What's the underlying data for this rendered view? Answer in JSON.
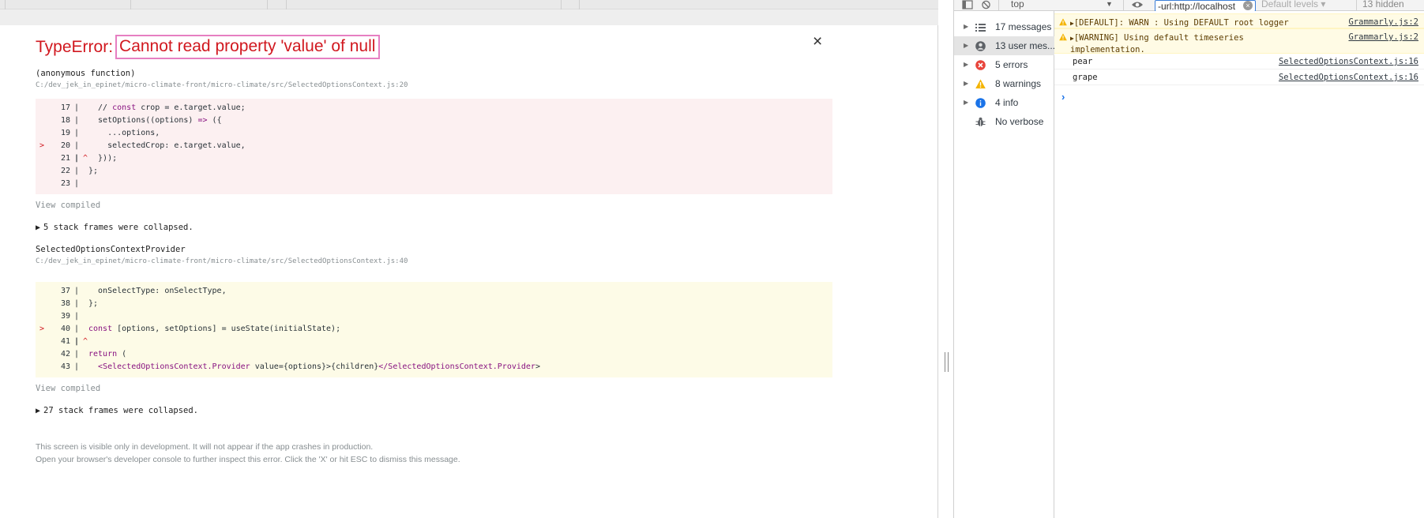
{
  "error": {
    "type": "TypeError:",
    "message": "Cannot read property 'value' of null",
    "close": "×"
  },
  "frame1": {
    "function": "(anonymous function)",
    "path": "C:/dev_jek_in_epinet/micro-climate-front/micro-climate/src/SelectedOptionsContext.js:20",
    "lines": [
      {
        "num": "17",
        "code": "  // const crop = e.target.value;"
      },
      {
        "num": "18",
        "code": "  setOptions((options) => ({"
      },
      {
        "num": "19",
        "code": "    ...options,"
      },
      {
        "num": "20",
        "code": "    selectedCrop: e.target.value,",
        "marker": ">"
      },
      {
        "num": "21",
        "code": "  }));",
        "caret": "^"
      },
      {
        "num": "22",
        "code": "};"
      },
      {
        "num": "23",
        "code": ""
      }
    ],
    "view_compiled": "View compiled",
    "collapsed": "5 stack frames were collapsed."
  },
  "frame2": {
    "function": "SelectedOptionsContextProvider",
    "path": "C:/dev_jek_in_epinet/micro-climate-front/micro-climate/src/SelectedOptionsContext.js:40",
    "lines": [
      {
        "num": "37",
        "code": "  onSelectType: onSelectType,"
      },
      {
        "num": "38",
        "code": "};"
      },
      {
        "num": "39",
        "code": ""
      },
      {
        "num": "40",
        "code": "const [options, setOptions] = useState(initialState);",
        "marker": ">"
      },
      {
        "num": "41",
        "code": "",
        "caret": "^"
      },
      {
        "num": "42",
        "code": "return ("
      },
      {
        "num": "43",
        "code": "  <SelectedOptionsContext.Provider value={options}>{children}</SelectedOptionsContext.Provider>"
      }
    ],
    "view_compiled": "View compiled",
    "collapsed": "27 stack frames were collapsed."
  },
  "footer": {
    "line1": "This screen is visible only in development. It will not appear if the app crashes in production.",
    "line2": "Open your browser's developer console to further inspect this error.  Click the 'X' or hit ESC to dismiss this message."
  },
  "devtools": {
    "context": "top",
    "filter_value": "-url:http://localhost",
    "levels": "Default levels ▾",
    "hidden": "13 hidden",
    "sidebar": [
      {
        "label": "17 messages",
        "icon": "list-icon"
      },
      {
        "label": "13 user mes...",
        "icon": "user-icon",
        "selected": true
      },
      {
        "label": "5 errors",
        "icon": "error-icon"
      },
      {
        "label": "8 warnings",
        "icon": "warning-icon"
      },
      {
        "label": "4 info",
        "icon": "info-icon"
      },
      {
        "label": "No verbose",
        "icon": "bug-icon"
      }
    ],
    "messages": [
      {
        "level": "warn",
        "text": "[DEFAULT]: WARN : Using DEFAULT root logger",
        "source": "Grammarly.js:2"
      },
      {
        "level": "warn",
        "text": "[WARNING] Using default timeseries\nimplementation.",
        "source": "Grammarly.js:2"
      },
      {
        "level": "log",
        "text": "pear",
        "source": "SelectedOptionsContext.js:16"
      },
      {
        "level": "log",
        "text": "grape",
        "source": "SelectedOptionsContext.js:16"
      }
    ],
    "prompt": "›"
  },
  "colors": {
    "error_red": "#d1181f",
    "highlight_pink": "#e67fc2",
    "warn_bg": "#fffbe5"
  }
}
